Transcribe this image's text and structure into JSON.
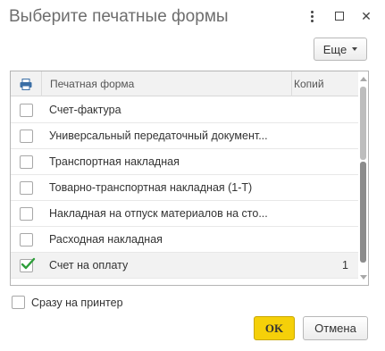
{
  "window": {
    "title": "Выберите печатные формы",
    "menu_icon": "more-vertical-icon",
    "maximize_icon": "maximize-icon",
    "close_icon": "close-icon",
    "close_glyph": "✕"
  },
  "toolbar": {
    "more_label": "Еще"
  },
  "table": {
    "header_icon": "printer-icon",
    "columns": {
      "name": "Печатная форма",
      "copies": "Копий"
    },
    "rows": [
      {
        "name": "Счет-фактура",
        "checked": false,
        "copies": ""
      },
      {
        "name": "Универсальный передаточный документ...",
        "checked": false,
        "copies": ""
      },
      {
        "name": "Транспортная накладная",
        "checked": false,
        "copies": ""
      },
      {
        "name": "Товарно-транспортная накладная (1-Т)",
        "checked": false,
        "copies": ""
      },
      {
        "name": "Накладная на отпуск материалов на сто...",
        "checked": false,
        "copies": ""
      },
      {
        "name": "Расходная накладная",
        "checked": false,
        "copies": ""
      },
      {
        "name": "Счет на оплату",
        "checked": true,
        "copies": "1"
      }
    ]
  },
  "options": {
    "print_immediately_label": "Сразу на принтер",
    "print_immediately_checked": false
  },
  "buttons": {
    "ok_label": "OK",
    "cancel_label": "Отмена"
  },
  "colors": {
    "ok_button": "#f5d009",
    "check_mark": "#2e9e3a"
  }
}
